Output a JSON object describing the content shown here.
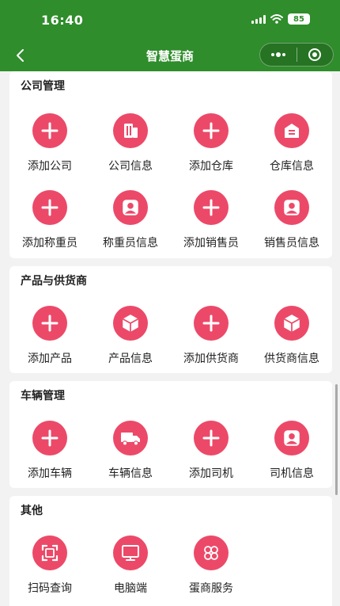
{
  "status_bar": {
    "time": "16:40",
    "battery": "85"
  },
  "nav": {
    "title": "智慧蛋商"
  },
  "colors": {
    "brand_green": "#2f8d2b",
    "icon_pink": "#ec4968",
    "page_bg": "#f2f2f2"
  },
  "sections": [
    {
      "title": "公司管理",
      "items": [
        {
          "label": "添加公司",
          "icon": "plus-icon"
        },
        {
          "label": "公司信息",
          "icon": "building-icon"
        },
        {
          "label": "添加仓库",
          "icon": "plus-icon"
        },
        {
          "label": "仓库信息",
          "icon": "warehouse-icon"
        },
        {
          "label": "添加称重员",
          "icon": "plus-icon"
        },
        {
          "label": "称重员信息",
          "icon": "user-icon"
        },
        {
          "label": "添加销售员",
          "icon": "plus-icon"
        },
        {
          "label": "销售员信息",
          "icon": "user-icon"
        }
      ]
    },
    {
      "title": "产品与供货商",
      "items": [
        {
          "label": "添加产品",
          "icon": "plus-icon"
        },
        {
          "label": "产品信息",
          "icon": "box-icon"
        },
        {
          "label": "添加供货商",
          "icon": "plus-icon"
        },
        {
          "label": "供货商信息",
          "icon": "box-icon"
        }
      ]
    },
    {
      "title": "车辆管理",
      "items": [
        {
          "label": "添加车辆",
          "icon": "plus-icon"
        },
        {
          "label": "车辆信息",
          "icon": "truck-icon"
        },
        {
          "label": "添加司机",
          "icon": "plus-icon"
        },
        {
          "label": "司机信息",
          "icon": "user-icon"
        }
      ]
    },
    {
      "title": "其他",
      "items": [
        {
          "label": "扫码查询",
          "icon": "scan-icon"
        },
        {
          "label": "电脑端",
          "icon": "monitor-icon"
        },
        {
          "label": "蛋商服务",
          "icon": "clover-icon"
        }
      ]
    }
  ]
}
